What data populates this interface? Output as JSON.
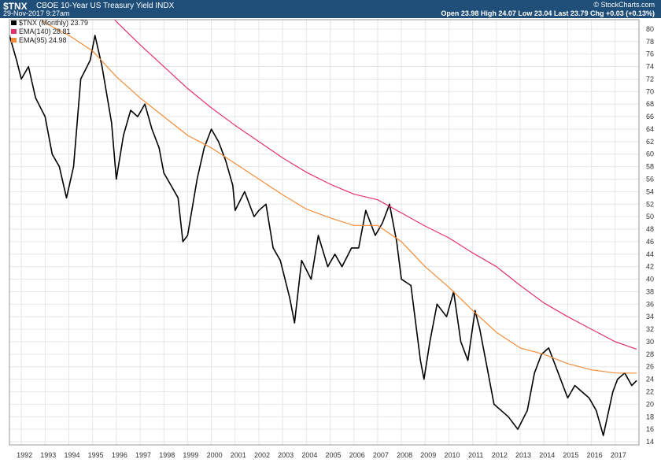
{
  "header": {
    "symbol": "$TNX",
    "description": "CBOE 10-Year US Treasury Yield",
    "exchange": "INDX",
    "date": "29-Nov-2017 9:27am",
    "brand": "© StockCharts.com",
    "quote": "Open 23.98  High 24.07  Low 23.04  Last 23.79  Chg +0.03 (+0.13%)"
  },
  "legend": [
    {
      "label": "$TNX (Monthly) 23.79",
      "color": "#000000"
    },
    {
      "label": "EMA(140) 28.81",
      "color": "#e0336e"
    },
    {
      "label": "EMA(95) 24.98",
      "color": "#f28c3a"
    }
  ],
  "colors": {
    "price": "#000000",
    "ema140": "#e0336e",
    "ema95": "#f28c3a",
    "header": "#1f4e79",
    "grid": "#e6e6e6"
  },
  "chart_data": {
    "type": "line",
    "ylim": [
      13.5,
      81.5
    ],
    "yticks": [
      14,
      16,
      18,
      20,
      22,
      24,
      26,
      28,
      30,
      32,
      34,
      36,
      38,
      40,
      42,
      44,
      46,
      48,
      50,
      52,
      54,
      56,
      58,
      60,
      62,
      64,
      66,
      68,
      70,
      72,
      74,
      76,
      78,
      80
    ],
    "xlim": [
      1991.5,
      2018.0
    ],
    "xticks": [
      "1992",
      "1993",
      "1994",
      "1995",
      "1996",
      "1997",
      "1998",
      "1999",
      "2000",
      "2001",
      "2002",
      "2003",
      "2004",
      "2005",
      "2006",
      "2007",
      "2008",
      "2009",
      "2010",
      "2011",
      "2012",
      "2013",
      "2014",
      "2015",
      "2016",
      "2017"
    ],
    "grid": true,
    "series": [
      {
        "name": "$TNX (Monthly)",
        "x": [
          1991.5,
          1991.8,
          1992.0,
          1992.3,
          1992.6,
          1993.0,
          1993.3,
          1993.6,
          1993.9,
          1994.2,
          1994.5,
          1994.9,
          1995.1,
          1995.4,
          1995.8,
          1996.0,
          1996.3,
          1996.6,
          1996.9,
          1997.2,
          1997.5,
          1997.8,
          1998.0,
          1998.3,
          1998.6,
          1998.8,
          1999.0,
          1999.4,
          1999.7,
          2000.0,
          2000.3,
          2000.6,
          2000.9,
          2001.0,
          2001.4,
          2001.8,
          2002.0,
          2002.3,
          2002.6,
          2002.9,
          2003.3,
          2003.5,
          2003.8,
          2004.2,
          2004.5,
          2004.9,
          2005.2,
          2005.5,
          2005.9,
          2006.2,
          2006.5,
          2006.9,
          2007.2,
          2007.5,
          2007.8,
          2008.0,
          2008.4,
          2008.8,
          2008.95,
          2009.2,
          2009.5,
          2009.9,
          2010.2,
          2010.5,
          2010.8,
          2011.1,
          2011.3,
          2011.6,
          2011.9,
          2012.2,
          2012.5,
          2012.9,
          2013.3,
          2013.6,
          2013.9,
          2014.2,
          2014.6,
          2015.0,
          2015.3,
          2015.6,
          2015.9,
          2016.2,
          2016.5,
          2016.9,
          2017.1,
          2017.4,
          2017.7,
          2017.9
        ],
        "values": [
          79,
          75,
          72,
          74,
          69,
          66,
          60,
          58,
          53,
          58,
          72,
          75,
          79,
          74,
          65,
          56,
          63,
          67,
          66,
          68,
          64,
          61,
          57,
          55,
          53,
          46,
          47,
          56,
          61,
          64,
          62,
          59,
          55,
          51,
          54,
          50,
          51,
          52,
          45,
          43,
          37,
          33,
          43,
          40,
          47,
          42,
          44,
          42,
          45,
          45,
          51,
          47,
          49,
          52,
          46,
          40,
          39,
          27,
          24,
          30,
          36,
          34,
          38,
          30,
          27,
          35,
          32,
          26,
          20,
          19,
          18,
          16,
          19,
          25,
          28,
          29,
          25,
          21,
          23,
          22,
          21,
          19,
          15,
          22,
          24,
          25,
          23,
          23.79
        ]
      },
      {
        "name": "EMA(140)",
        "x": [
          1995.1,
          1996.0,
          1997.0,
          1998.0,
          1999.0,
          2000.0,
          2001.0,
          2002.0,
          2003.0,
          2004.0,
          2005.0,
          2006.0,
          2007.0,
          2008.0,
          2009.0,
          2010.0,
          2011.0,
          2012.0,
          2013.0,
          2014.0,
          2015.0,
          2016.0,
          2017.0,
          2017.9
        ],
        "values": [
          85,
          81.2,
          77.5,
          74,
          70.5,
          67.4,
          64.6,
          62,
          59.4,
          57.1,
          55.2,
          53.6,
          52.7,
          50.6,
          48.5,
          46.6,
          44.2,
          42,
          39,
          36.2,
          34,
          32,
          30,
          28.81
        ]
      },
      {
        "name": "EMA(95)",
        "x": [
          1991.8,
          1992.5,
          1993.0,
          1994.0,
          1995.0,
          1996.0,
          1997.0,
          1998.0,
          1999.0,
          2000.0,
          2001.0,
          2002.0,
          2003.0,
          2004.0,
          2005.0,
          2006.0,
          2007.0,
          2008.0,
          2009.0,
          2010.0,
          2011.0,
          2012.0,
          2013.0,
          2014.0,
          2015.0,
          2016.0,
          2017.0,
          2017.9
        ],
        "values": [
          85,
          83,
          81,
          79,
          76.5,
          72.4,
          69,
          66,
          63,
          61,
          58.5,
          56,
          53.5,
          51.2,
          49.8,
          48.6,
          48.6,
          46,
          42,
          38.7,
          35,
          31.5,
          29,
          28,
          26.5,
          25.5,
          25,
          24.98
        ]
      }
    ]
  }
}
